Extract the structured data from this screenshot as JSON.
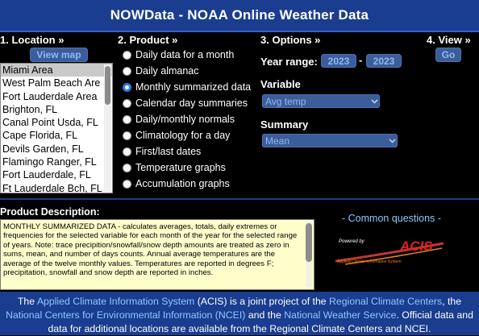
{
  "header": {
    "title": "NOWData - NOAA Online Weather Data"
  },
  "location": {
    "heading": "1. Location »",
    "view_map": "View map",
    "items": [
      "Miami Area",
      "West Palm Beach Are",
      "Fort Lauderdale Area",
      "Brighton, FL",
      "Canal Point Usda, FL",
      "Cape Florida, FL",
      "Devils Garden, FL",
      "Flamingo Ranger, FL",
      "Fort Lauderdale, FL",
      "Ft Lauderdale Bch, FL"
    ],
    "selected": "Miami Area"
  },
  "product": {
    "heading": "2. Product »",
    "options": [
      "Daily data for a month",
      "Daily almanac",
      "Monthly summarized data",
      "Calendar day summaries",
      "Daily/monthly normals",
      "Climatology for a day",
      "First/last dates",
      "Temperature graphs",
      "Accumulation graphs"
    ],
    "selected": "Monthly summarized data"
  },
  "options": {
    "heading": "3. Options »",
    "year_range_label": "Year range:",
    "year_start": "2023",
    "year_sep": "-",
    "year_end": "2023",
    "variable_label": "Variable",
    "variable_value": "Avg temp",
    "summary_label": "Summary",
    "summary_value": "Mean"
  },
  "view": {
    "heading": "4. View »",
    "go": "Go"
  },
  "description": {
    "heading": "Product Description:",
    "text": "MONTHLY SUMMARIZED DATA - calculates averages, totals, daily extremes or frequencies for the selected variable for each month of the year for the selected range of years. Note: trace precipition/snowfall/snow depth amounts are treated as zero in sums, mean, and number of days counts. Annual average temperatures are the average of the twelve monthly values. Temperatures are reported in degrees F; precipitation, snowfall and snow depth are reported in inches."
  },
  "common_questions": "- Common questions -",
  "logo": {
    "powered": "Powered by",
    "name": "ACIS",
    "tagline": "Applied Climate Information System"
  },
  "footer": {
    "t1": "The ",
    "l1": "Applied Climate Information System",
    "t2": " (ACIS) is a joint project of the ",
    "l2": "Regional Climate Centers",
    "t3": ", the ",
    "l3": "National Centers for Environmental Information (NCEI)",
    "t4": " and the ",
    "l4": "National Weather Service",
    "t5": ". Official data and data for additional locations are available from the Regional Climate Centers and NCEI."
  },
  "colors": {
    "header_bg": "#1a3d8f",
    "button_bg": "#3b5e9b",
    "button_text": "#8fb7f3",
    "link": "#8ec8ff",
    "desc_bg": "#ffffcc"
  }
}
